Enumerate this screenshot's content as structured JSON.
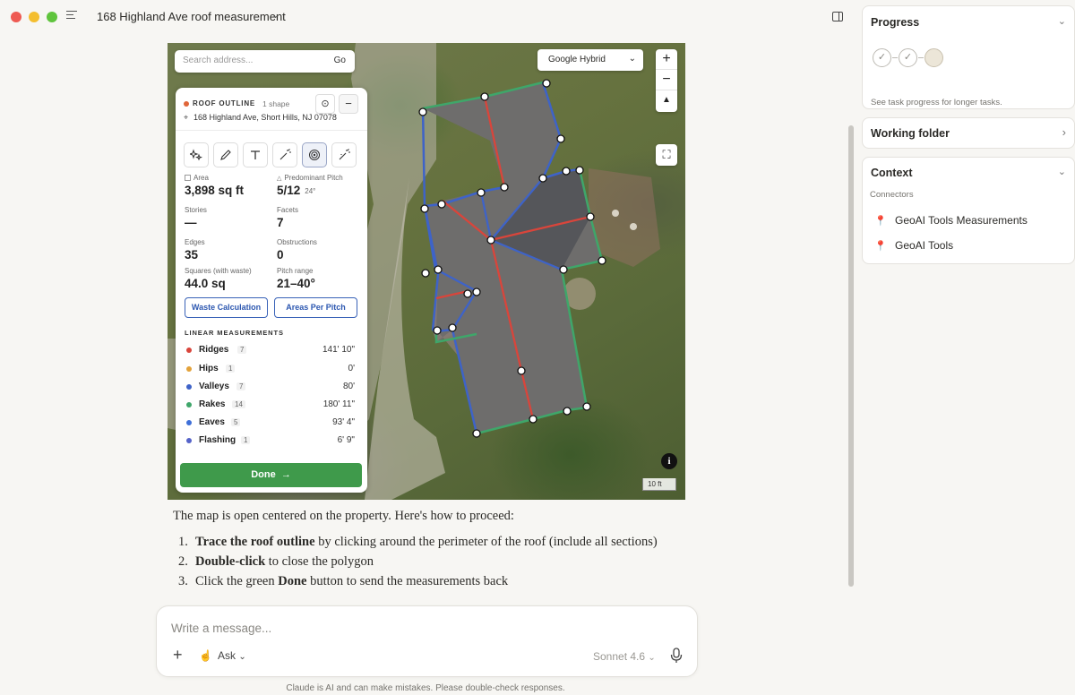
{
  "window": {
    "title": "168 Highland Ave roof measurement"
  },
  "map": {
    "search_placeholder": "Search address...",
    "go_label": "Go",
    "layer": "Google Hybrid",
    "zoom_in": "+",
    "zoom_out": "−",
    "scale": "10 ft",
    "info": "i"
  },
  "panel": {
    "title": "ROOF OUTLINE",
    "shape_count": "1 shape",
    "address": "168 Highland Ave, Short Hills, NJ 07078",
    "stats": {
      "area_label": "Area",
      "area_value": "3,898 sq ft",
      "pitch_label": "Predominant Pitch",
      "pitch_value": "5/12",
      "pitch_deg": "24°",
      "stories_label": "Stories",
      "stories_value": "—",
      "facets_label": "Facets",
      "facets_value": "7",
      "edges_label": "Edges",
      "edges_value": "35",
      "obstructions_label": "Obstructions",
      "obstructions_value": "0",
      "squares_label": "Squares (with waste)",
      "squares_value": "44.0 sq",
      "pitch_range_label": "Pitch range",
      "pitch_range_value": "21–40°"
    },
    "waste_button": "Waste Calculation",
    "areas_button": "Areas Per Pitch",
    "linear_title": "LINEAR MEASUREMENTS",
    "linear": [
      {
        "name": "Ridges",
        "count": "7",
        "value": "141' 10\"",
        "color": "#d9453b"
      },
      {
        "name": "Hips",
        "count": "1",
        "value": "0'",
        "color": "#e3a23a"
      },
      {
        "name": "Valleys",
        "count": "7",
        "value": "80'",
        "color": "#3e63c8"
      },
      {
        "name": "Rakes",
        "count": "14",
        "value": "180' 11\"",
        "color": "#3fa66a"
      },
      {
        "name": "Eaves",
        "count": "5",
        "value": "93' 4\"",
        "color": "#3e6fd8"
      },
      {
        "name": "Flashing",
        "count": "1",
        "value": "6' 9\"",
        "color": "#5563c9"
      }
    ],
    "done_label": "Done",
    "done_arrow": "→"
  },
  "message": {
    "intro": "The map is open centered on the property. Here's how to proceed:",
    "steps": [
      {
        "num": "1.",
        "bold": "Trace the roof outline",
        "rest": " by clicking around the perimeter of the roof (include all sections)"
      },
      {
        "num": "2.",
        "bold": "Double-click",
        "rest": " to close the polygon"
      },
      {
        "num": "3.",
        "pre": "Click the green ",
        "bold": "Done",
        "rest": " button to send the measurements back"
      }
    ]
  },
  "composer": {
    "placeholder": "Write a message...",
    "plus": "+",
    "mode": "Ask",
    "model": "Sonnet 4.6",
    "disclaimer": "Claude is AI and can make mistakes. Please double-check responses."
  },
  "sidebar": {
    "progress_title": "Progress",
    "progress_hint": "See task progress for longer tasks.",
    "working_folder_title": "Working folder",
    "context_title": "Context",
    "connectors_label": "Connectors",
    "connectors": [
      "GeoAI Tools Measurements",
      "GeoAI Tools"
    ]
  },
  "colors": {
    "accent_green": "#3f9a4b",
    "ridge_red": "#d9453b",
    "valley_blue": "#3e63c8",
    "rake_green": "#3fa66a",
    "connector_blue": "#3e6fd8"
  }
}
